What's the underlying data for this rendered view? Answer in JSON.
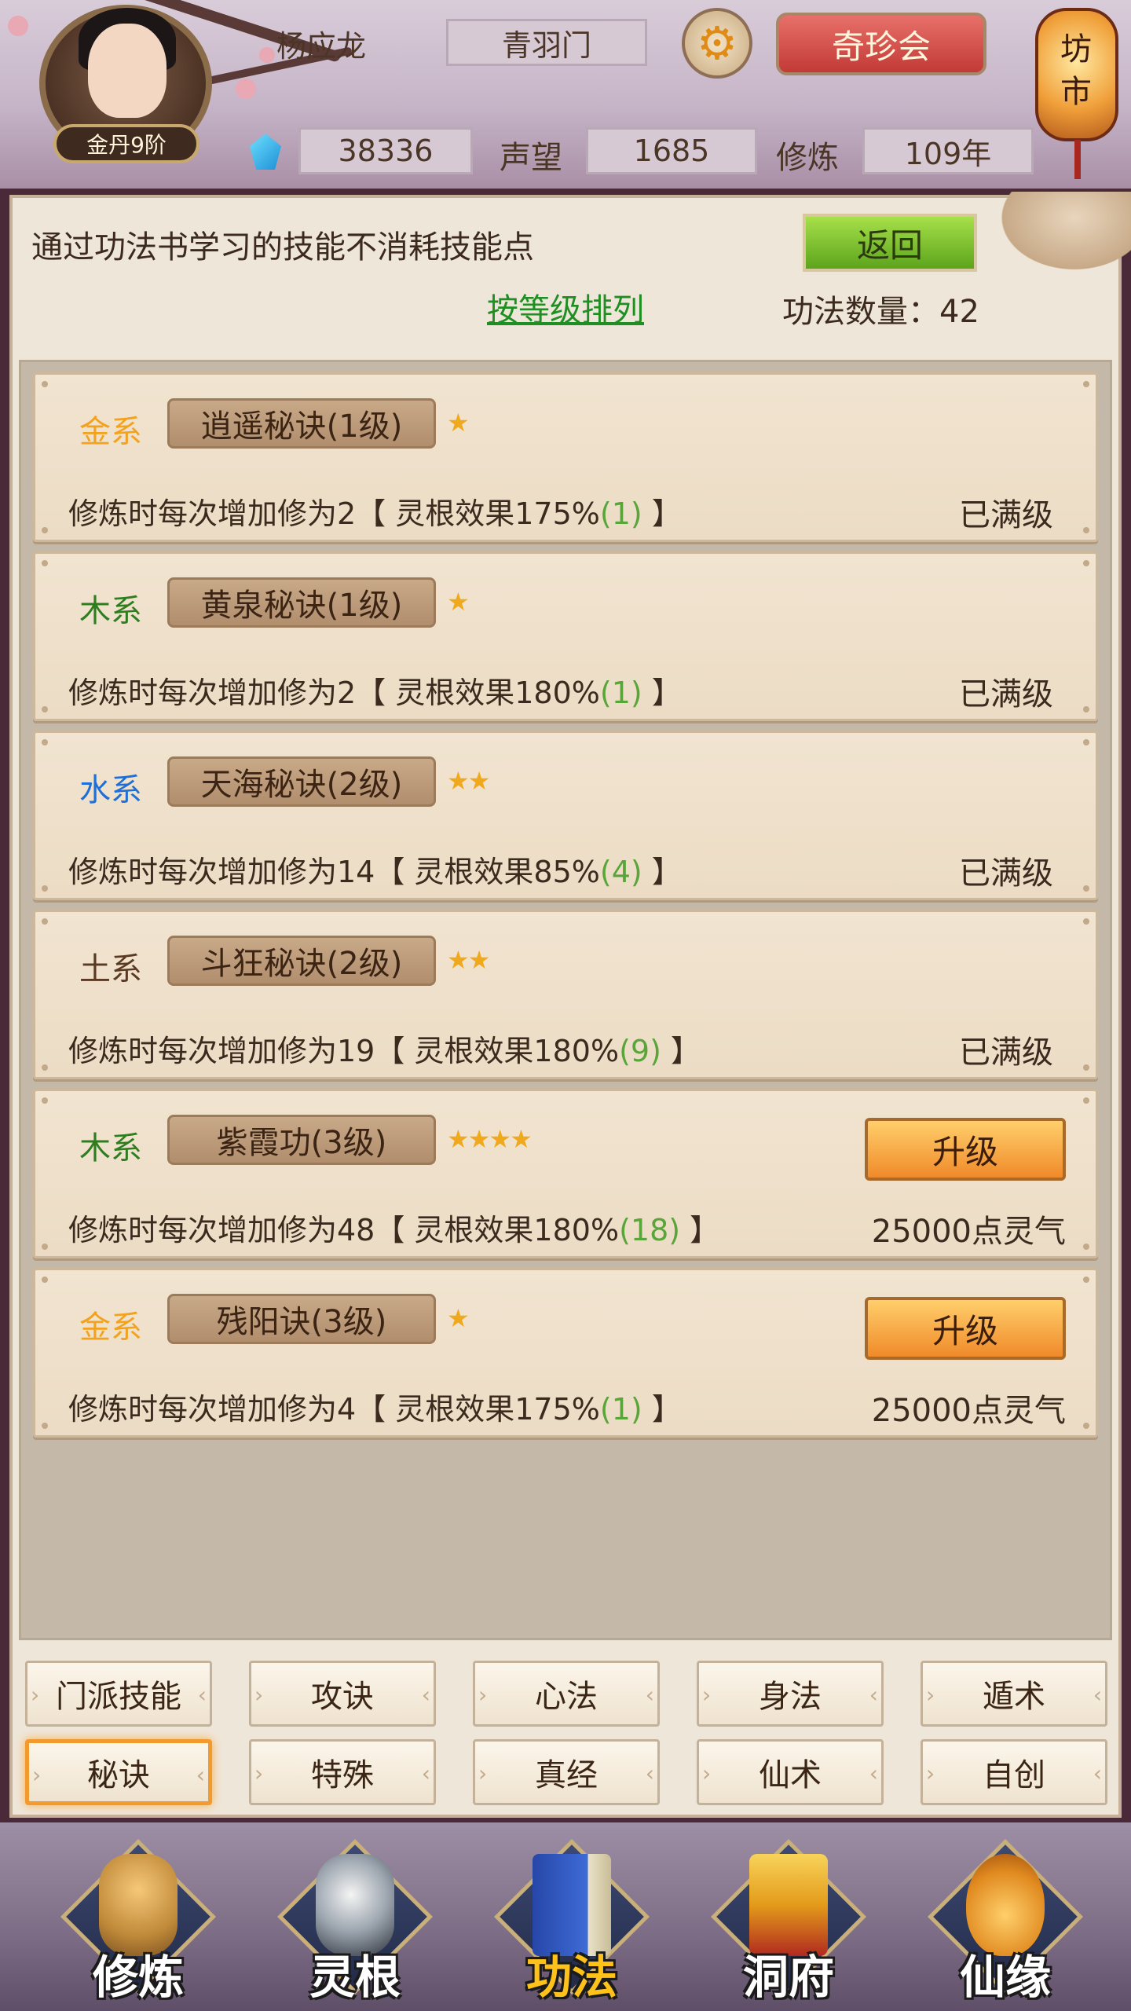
{
  "header": {
    "player_name": "杨应龙",
    "rank_badge": "金丹9阶",
    "sect": "青羽门",
    "treasure_button": "奇珍会",
    "lantern_text": "坊市",
    "gems": "38336",
    "fame_label": "声望",
    "fame_value": "1685",
    "train_label": "修炼",
    "train_value": "109年"
  },
  "panel": {
    "info_text": "通过功法书学习的技能不消耗技能点",
    "back_button": "返回",
    "sort_link": "按等级排列",
    "count_label": "功法数量：",
    "count_value": "42"
  },
  "skills": [
    {
      "element": "金系",
      "element_color": "#f2a21c",
      "name": "逍遥秘诀(1级)",
      "stars": "★",
      "desc_pre": "修炼时每次增加修为2【 灵根效果175%",
      "desc_num": "(1)",
      "desc_post": " 】",
      "status": "已满级"
    },
    {
      "element": "木系",
      "element_color": "#2e7d1f",
      "name": "黄泉秘诀(1级)",
      "stars": "★",
      "desc_pre": "修炼时每次增加修为2【 灵根效果180%",
      "desc_num": "(1)",
      "desc_post": " 】",
      "status": "已满级"
    },
    {
      "element": "水系",
      "element_color": "#1f6fd6",
      "name": "天海秘诀(2级)",
      "stars": "★★",
      "desc_pre": "修炼时每次增加修为14【 灵根效果85%",
      "desc_num": "(4)",
      "desc_post": " 】",
      "status": "已满级"
    },
    {
      "element": "土系",
      "element_color": "#5a3a22",
      "name": "斗狂秘诀(2级)",
      "stars": "★★",
      "desc_pre": "修炼时每次增加修为19【 灵根效果180%",
      "desc_num": "(9)",
      "desc_post": " 】",
      "status": "已满级"
    },
    {
      "element": "木系",
      "element_color": "#2e7d1f",
      "name": "紫霞功(3级)",
      "stars": "★★★★",
      "desc_pre": "修炼时每次增加修为48【 灵根效果180%",
      "desc_num": "(18)",
      "desc_post": " 】",
      "upgrade": "升级",
      "cost": "25000点灵气"
    },
    {
      "element": "金系",
      "element_color": "#f2a21c",
      "name": "残阳诀(3级)",
      "stars": "★",
      "desc_pre": "修炼时每次增加修为4【 灵根效果175%",
      "desc_num": "(1)",
      "desc_post": " 】",
      "upgrade": "升级",
      "cost": "25000点灵气"
    }
  ],
  "tabs": [
    "门派技能",
    "攻诀",
    "心法",
    "身法",
    "遁术",
    "秘诀",
    "特殊",
    "真经",
    "仙术",
    "自创"
  ],
  "active_tab": "秘诀",
  "nav": [
    {
      "label": "修炼",
      "icon": "monk-icon"
    },
    {
      "label": "灵根",
      "icon": "yin-yang-sword-icon"
    },
    {
      "label": "功法",
      "icon": "book-icon"
    },
    {
      "label": "洞府",
      "icon": "pagoda-icon"
    },
    {
      "label": "仙缘",
      "icon": "gourd-icon"
    }
  ],
  "active_nav": "功法",
  "colors": {
    "accent_orange": "#f08a2a",
    "back_green": "#5ca41c",
    "link_green": "#1f8f23",
    "gold_element": "#f2a21c",
    "wood_element": "#2e7d1f",
    "water_element": "#1f6fd6"
  }
}
